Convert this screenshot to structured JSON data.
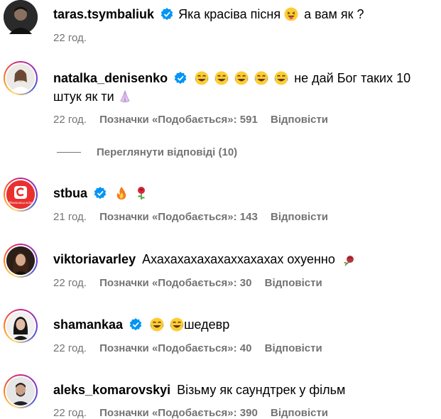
{
  "comments": [
    {
      "username": "taras.tsymbaliuk",
      "verified": true,
      "text_before": "Яка красіва пісня",
      "emoji": "squinting-tongue-emoji",
      "text_after": "а вам як ?",
      "time": "22 год.",
      "has_likes": false
    },
    {
      "username": "natalka_denisenko",
      "verified": true,
      "emojis": [
        "tears-of-joy-emoji",
        "tears-of-joy-emoji",
        "tears-of-joy-emoji",
        "tears-of-joy-emoji",
        "tears-of-joy-emoji"
      ],
      "text": "не дай Бог таких 10 штук як ти",
      "trailing_emoji": "folded-hands-emoji",
      "time": "22 год.",
      "likes": "Позначки «Подобається»: 591",
      "reply": "Відповісти"
    },
    {
      "username": "stbua",
      "verified": true,
      "emojis": [
        "fire-emoji",
        "rose-emoji"
      ],
      "time": "21 год.",
      "likes": "Позначки «Подобається»: 143",
      "reply": "Відповісти",
      "avatar_caption": "Мамахаєш всім"
    },
    {
      "username": "viktoriavarley",
      "verified": false,
      "text": "Ахахахахахахаххахахах охуенно",
      "trailing_emoji": "wilted-rose-emoji",
      "time": "22 год.",
      "likes": "Позначки «Подобається»: 30",
      "reply": "Відповісти"
    },
    {
      "username": "shamankaa",
      "verified": true,
      "emojis": [
        "tears-of-joy-emoji",
        "tears-of-joy-emoji"
      ],
      "text": "шедевр",
      "time": "22 год.",
      "likes": "Позначки «Подобається»: 40",
      "reply": "Відповісти"
    },
    {
      "username": "aleks_komarovskyi",
      "verified": false,
      "text": "Візьму як саундтрек у фільм",
      "time": "22 год.",
      "likes": "Позначки «Подобається»: 390",
      "reply": "Відповісти"
    }
  ],
  "view_replies": "Переглянути відповіді (10)",
  "colors": {
    "meta": "#737373",
    "verified": "#0095f6",
    "stb_red": "#e8312f"
  }
}
